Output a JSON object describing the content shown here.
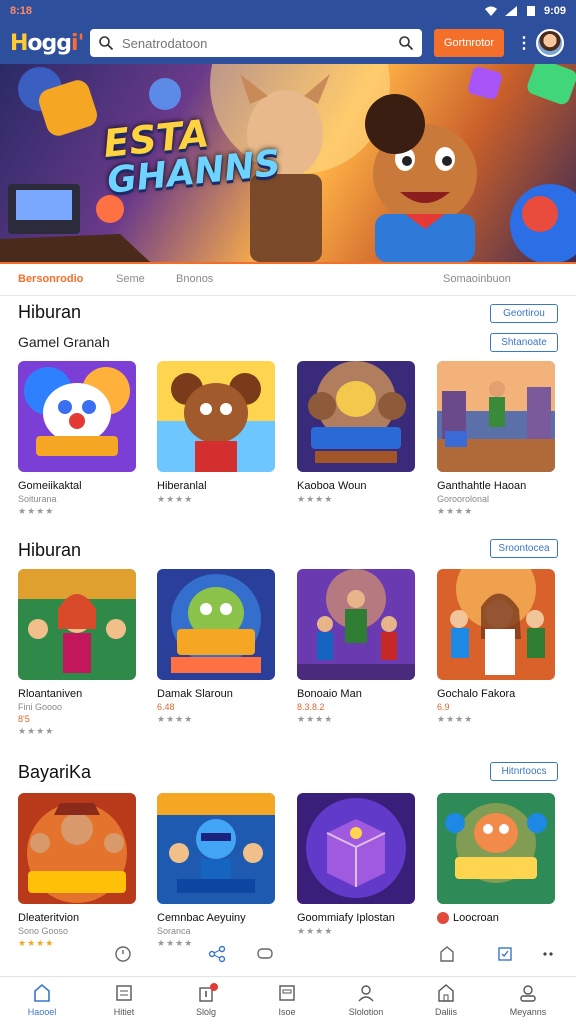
{
  "status_bar": {
    "left": "8:18",
    "right": "9:09"
  },
  "header": {
    "logo": [
      "H",
      "ogg",
      "i'"
    ],
    "search": {
      "value": "Senatrodatoon",
      "placeholder": "Senatrodatoon"
    },
    "primary_button": "Gortnrotor"
  },
  "hero": {
    "title_line1": "ESTA",
    "title_line2": "GHANNS"
  },
  "tabs": [
    "Bersonrodio",
    "Seme",
    "Bnonos",
    "Somaoinbuon"
  ],
  "sections": [
    {
      "title": "Hiburan",
      "subtitle": "Gamel Granah",
      "buttons": [
        "Geortirou",
        "Shtanoate"
      ],
      "cards": [
        {
          "title": "Gomeiikaktal",
          "sub": "Soiturana",
          "rating": "★★★★",
          "price": ""
        },
        {
          "title": "Hiberanlal",
          "sub": "",
          "rating": "★★★★",
          "price": ""
        },
        {
          "title": "Kaoboa Woun",
          "sub": "",
          "rating": "★★★★",
          "price": ""
        },
        {
          "title": "Ganthahtle Haoan",
          "sub": "Goroorolonal",
          "rating": "★★★★",
          "price": ""
        }
      ]
    },
    {
      "title": "Hiburan",
      "subtitle": "",
      "buttons": [
        "Sroontocea"
      ],
      "cards": [
        {
          "title": "Rloantaniven",
          "sub": "Fini Goooo",
          "rating": "★★★★",
          "price": "8'5"
        },
        {
          "title": "Damak Slaroun",
          "sub": "",
          "rating": "★★★★",
          "price": "6.48"
        },
        {
          "title": "Bonoaio Man",
          "sub": "",
          "rating": "★★★★",
          "price": "8.3.8.2"
        },
        {
          "title": "Gochalo Fakora",
          "sub": "",
          "rating": "★★★★",
          "price": "6.9"
        }
      ]
    },
    {
      "title": "BayariKa",
      "subtitle": "",
      "buttons": [
        "Hitnrtoocs"
      ],
      "cards": [
        {
          "title": "Dleateritvion",
          "sub": "Sono Gooso",
          "rating": "★★★★",
          "price": ""
        },
        {
          "title": "Cemnbac Aeyuiny",
          "sub": "Soranca",
          "rating": "★★★★",
          "price": ""
        },
        {
          "title": "Goommiafy Iplostan",
          "sub": "",
          "rating": "★★★★",
          "price": ""
        },
        {
          "title": "Loocroan",
          "sub": "",
          "rating": "",
          "price": ""
        }
      ]
    }
  ],
  "bottom_nav": [
    {
      "label": "Haooel",
      "icon": "home-icon"
    },
    {
      "label": "Hitiet",
      "icon": "list-icon"
    },
    {
      "label": "Slolg",
      "icon": "bag-icon"
    },
    {
      "label": "Isoe",
      "icon": "book-icon"
    },
    {
      "label": "Slolotion",
      "icon": "person-icon"
    },
    {
      "label": "Daliis",
      "icon": "store-icon"
    },
    {
      "label": "Meyanns",
      "icon": "account-icon"
    }
  ],
  "colors": {
    "brand": "#2d4f9c",
    "accent": "#f4702a",
    "link": "#3b76c6"
  }
}
